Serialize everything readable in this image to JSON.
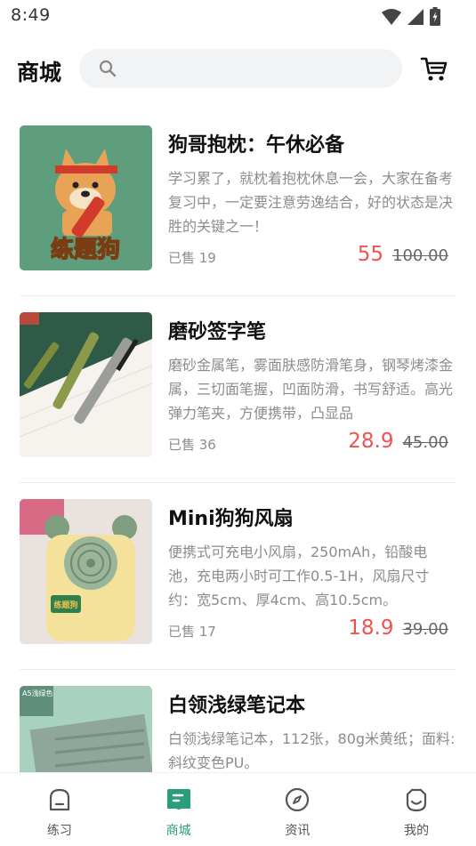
{
  "status_bar": {
    "time": "8:49"
  },
  "header": {
    "title": "商城",
    "search_placeholder": ""
  },
  "products": [
    {
      "name": "狗哥抱枕：午休必备",
      "description": "学习累了，就枕着抱枕休息一会，大家在备考复习中，一定要注意劳逸结合，好的状态是决胜的关键之一！",
      "sold": "已售 19",
      "price": "55",
      "original_price": "100.00",
      "image_text": "练题狗"
    },
    {
      "name": "磨砂签字笔",
      "description": "磨砂金属笔，雾面肤感防滑笔身，钢琴烤漆金属，三切面笔握，凹面防滑，书写舒适。高光弹力笔夹，方便携带，凸显品",
      "sold": "已售 36",
      "price": "28.9",
      "original_price": "45.00"
    },
    {
      "name": "Mini狗狗风扇",
      "description": "便携式可充电小风扇，250mAh，铅酸电池，充电两小时可工作0.5-1H，风扇尺寸约：宽5cm、厚4cm、高10.5cm。",
      "sold": "已售 17",
      "price": "18.9",
      "original_price": "39.00",
      "image_text": "练题狗"
    },
    {
      "name": "白领浅绿笔记本",
      "description": "白领浅绿笔记本，112张，80g米黄纸；面料:斜纹变色PU。",
      "image_text": "A5浅绿色"
    }
  ],
  "tabbar": {
    "tabs": [
      {
        "label": "练习",
        "icon": "practice-icon"
      },
      {
        "label": "商城",
        "icon": "mall-icon",
        "active": true
      },
      {
        "label": "资讯",
        "icon": "compass-icon"
      },
      {
        "label": "我的",
        "icon": "profile-icon"
      }
    ]
  },
  "colors": {
    "accent": "#2a9d7c",
    "price": "#ef5350",
    "search_bg": "#f2f3f5"
  }
}
